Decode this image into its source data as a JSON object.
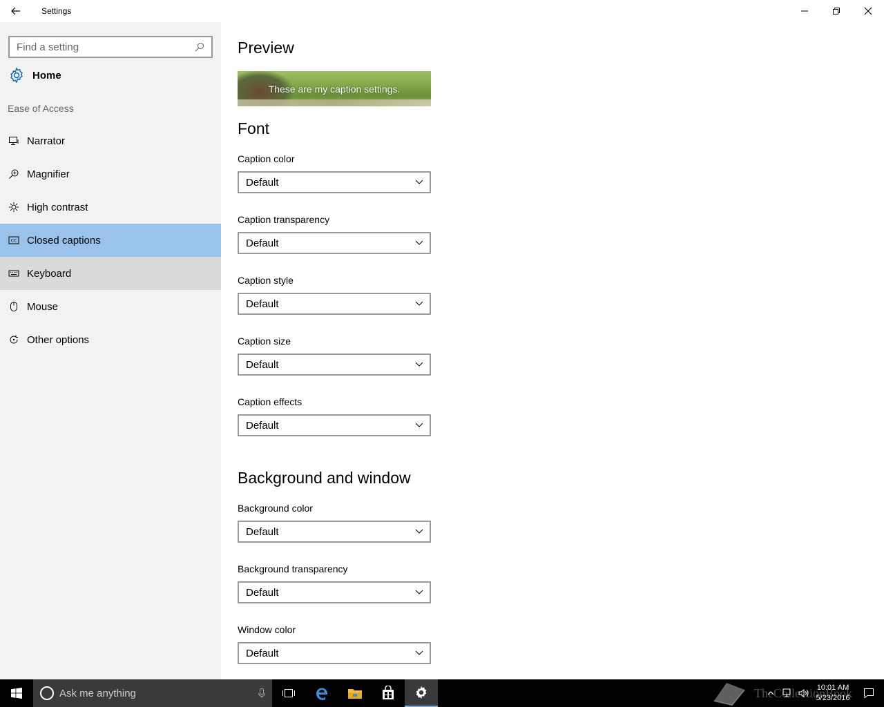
{
  "window": {
    "title": "Settings"
  },
  "sidebar": {
    "search_placeholder": "Find a setting",
    "home_label": "Home",
    "group_label": "Ease of Access",
    "items": [
      {
        "label": "Narrator",
        "icon": "narrator-icon"
      },
      {
        "label": "Magnifier",
        "icon": "magnifier-icon"
      },
      {
        "label": "High contrast",
        "icon": "high-contrast-icon"
      },
      {
        "label": "Closed captions",
        "icon": "closed-captions-icon",
        "state": "selected"
      },
      {
        "label": "Keyboard",
        "icon": "keyboard-icon",
        "state": "hover"
      },
      {
        "label": "Mouse",
        "icon": "mouse-icon"
      },
      {
        "label": "Other options",
        "icon": "other-options-icon"
      }
    ]
  },
  "main": {
    "preview_heading": "Preview",
    "preview_text": "These are my caption settings.",
    "font_heading": "Font",
    "font_fields": [
      {
        "label": "Caption color",
        "value": "Default"
      },
      {
        "label": "Caption transparency",
        "value": "Default"
      },
      {
        "label": "Caption style",
        "value": "Default"
      },
      {
        "label": "Caption size",
        "value": "Default"
      },
      {
        "label": "Caption effects",
        "value": "Default"
      }
    ],
    "background_heading": "Background and window",
    "background_fields": [
      {
        "label": "Background color",
        "value": "Default"
      },
      {
        "label": "Background transparency",
        "value": "Default"
      },
      {
        "label": "Window color",
        "value": "Default"
      }
    ]
  },
  "taskbar": {
    "search_text": "Ask me anything",
    "time": "10:01 AM",
    "date": "5/23/2016",
    "watermark": "TheCollectionBook"
  },
  "colors": {
    "selected": "#99c3ea",
    "hover": "#dadada",
    "sidebar_bg": "#f2f2f2",
    "accent": "#0063b1"
  }
}
